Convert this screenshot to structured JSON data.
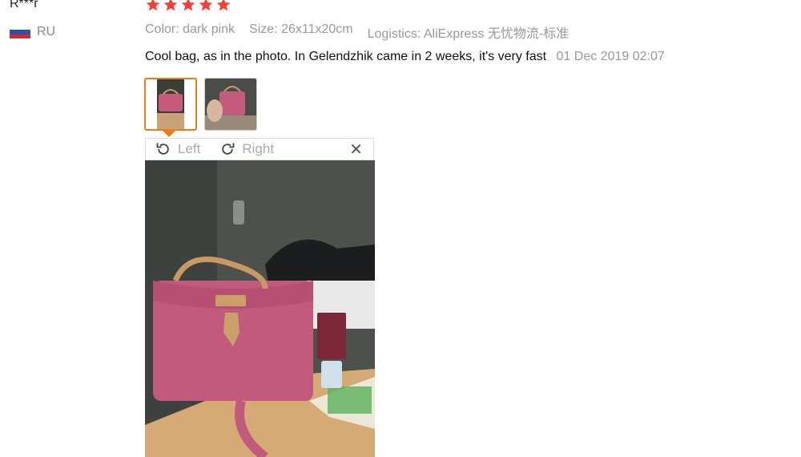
{
  "reviewer": {
    "name": "R***r",
    "country_code": "RU",
    "flag_colors": [
      "#ffffff",
      "#2c51a8",
      "#d8262d"
    ]
  },
  "rating": {
    "stars": 5,
    "star_color": "#f44336"
  },
  "meta": {
    "color": "Color: dark pink",
    "size": "Size: 26x11x20cm",
    "logistics": "Logistics: AliExpress 无忧物流-标准"
  },
  "review": {
    "text": "Cool bag, as in the photo. In Gelendzhik came in 2 weeks, it's very fast",
    "date": "01 Dec 2019 02:07"
  },
  "viewer": {
    "rotate_left_label": "Left",
    "rotate_right_label": "Right",
    "close_icon": "close-icon",
    "accent_color": "#f07a1a"
  }
}
